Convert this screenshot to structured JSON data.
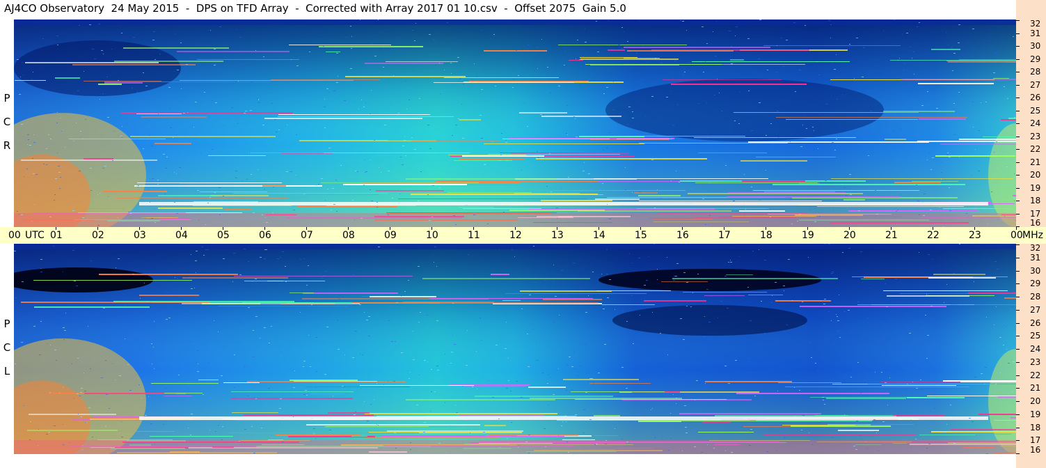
{
  "title": "AJ4CO Observatory  24 May 2015  -  DPS on TFD Array  -  Corrected with Array 2017 01 10.csv  -  Offset 2075  Gain 5.0",
  "panels": [
    {
      "id": "rcp",
      "polarization_letters": [
        "R",
        "C",
        "P"
      ]
    },
    {
      "id": "lcp",
      "polarization_letters": [
        "L",
        "C",
        "P"
      ]
    }
  ],
  "time_axis": {
    "labels": [
      "00",
      "UTC",
      "01",
      "02",
      "03",
      "04",
      "05",
      "06",
      "07",
      "08",
      "09",
      "10",
      "11",
      "12",
      "13",
      "14",
      "15",
      "16",
      "17",
      "18",
      "19",
      "20",
      "21",
      "22",
      "23",
      "00",
      "MHz"
    ]
  },
  "colors": {
    "title_bg": "#ffffff",
    "time_bar": "#ffffc8",
    "freq_panel": "#fde0c8",
    "spectro_low": "#000022",
    "spectro_mid": "#1f6cf0",
    "spectro_high": "#26d2d2",
    "spectro_hot": "#ff2090",
    "spectro_sat": "#ffffff"
  },
  "chart_data": {
    "type": "heatmap",
    "title": "AJ4CO Observatory  24 May 2015  -  DPS on TFD Array  -  Corrected with Array 2017 01 10.csv  -  Offset 2075  Gain 5.0",
    "xlabel": "UTC",
    "ylabel": "MHz",
    "x_ticks": [
      "00",
      "01",
      "02",
      "03",
      "04",
      "05",
      "06",
      "07",
      "08",
      "09",
      "10",
      "11",
      "12",
      "13",
      "14",
      "15",
      "16",
      "17",
      "18",
      "19",
      "20",
      "21",
      "22",
      "23",
      "00"
    ],
    "y_ticks": [
      "32",
      "31",
      "30",
      "29",
      "28",
      "27",
      "26",
      "25",
      "24",
      "23",
      "22",
      "21",
      "20",
      "19",
      "18",
      "17",
      "16"
    ],
    "xlim": [
      0,
      24
    ],
    "ylim": [
      16,
      32
    ],
    "panels": [
      "RCP",
      "LCP"
    ]
  }
}
